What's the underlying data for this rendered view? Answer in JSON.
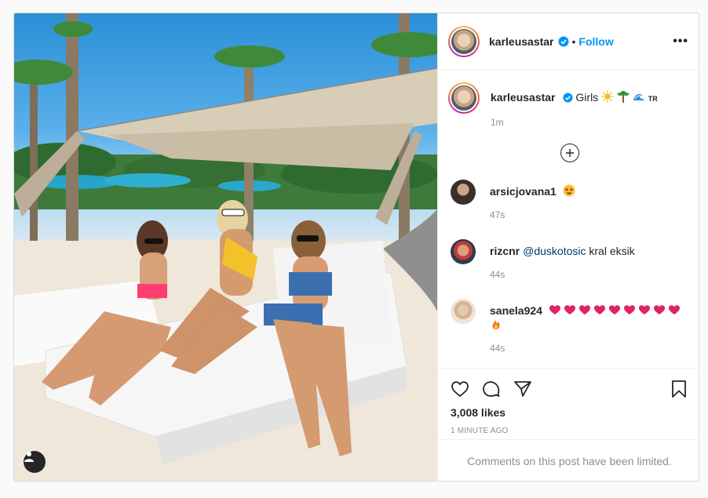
{
  "post": {
    "author": {
      "username": "karleusastar",
      "verified": true,
      "follow_label": "Follow",
      "separator": "•",
      "more_label": "•••"
    },
    "photo": {
      "description_icon": "user-tag-icon"
    },
    "caption": {
      "username": "karleusastar",
      "text": "Girls",
      "emojis": [
        "sun",
        "palm-tree",
        "wave",
        "TR"
      ],
      "time": "1m"
    },
    "load_more_icon": "plus-circle-icon",
    "comments": [
      {
        "username": "arsicjovana1",
        "text": "",
        "emojis": [
          "star-struck"
        ],
        "time": "47s"
      },
      {
        "username": "rizcnr",
        "mention": "@duskotosic",
        "text": "kral eksik",
        "emojis": [],
        "time": "44s"
      },
      {
        "username": "sanela924",
        "text": "",
        "emojis": [
          "heart",
          "heart",
          "heart",
          "heart",
          "heart",
          "heart",
          "heart",
          "heart",
          "heart",
          "fire"
        ],
        "time": "44s"
      }
    ],
    "likes": "3,008 likes",
    "posted_ago": "1 MINUTE AGO",
    "comments_limited": "Comments on this post have been limited.",
    "colors": {
      "link_blue": "#0095f6",
      "text_dark": "#262626",
      "text_muted": "#8e8e8e",
      "border": "#dbdbdb",
      "heart_red": "#e0245e"
    }
  }
}
